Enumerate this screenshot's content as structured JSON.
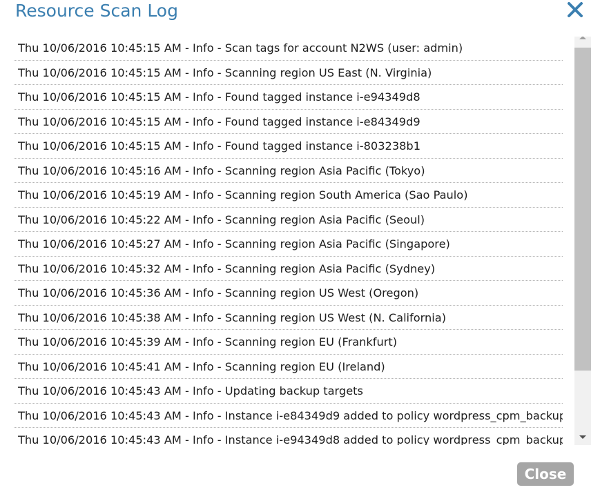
{
  "dialog": {
    "title": "Resource Scan Log",
    "close_icon": "close-x-icon",
    "close_button_label": "Close",
    "accent_color": "#3b7fb0",
    "button_color": "#a6a6a6"
  },
  "log": {
    "entries": [
      "Thu 10/06/2016 10:45:15 AM - Info - Scan tags for account N2WS (user: admin)",
      "Thu 10/06/2016 10:45:15 AM - Info - Scanning region US East (N. Virginia)",
      "Thu 10/06/2016 10:45:15 AM - Info - Found tagged instance i-e94349d8",
      "Thu 10/06/2016 10:45:15 AM - Info - Found tagged instance i-e84349d9",
      "Thu 10/06/2016 10:45:15 AM - Info - Found tagged instance i-803238b1",
      "Thu 10/06/2016 10:45:16 AM - Info - Scanning region Asia Pacific (Tokyo)",
      "Thu 10/06/2016 10:45:19 AM - Info - Scanning region South America (Sao Paulo)",
      "Thu 10/06/2016 10:45:22 AM - Info - Scanning region Asia Pacific (Seoul)",
      "Thu 10/06/2016 10:45:27 AM - Info - Scanning region Asia Pacific (Singapore)",
      "Thu 10/06/2016 10:45:32 AM - Info - Scanning region Asia Pacific (Sydney)",
      "Thu 10/06/2016 10:45:36 AM - Info - Scanning region US West (Oregon)",
      "Thu 10/06/2016 10:45:38 AM - Info - Scanning region US West (N. California)",
      "Thu 10/06/2016 10:45:39 AM - Info - Scanning region EU (Frankfurt)",
      "Thu 10/06/2016 10:45:41 AM - Info - Scanning region EU (Ireland)",
      "Thu 10/06/2016 10:45:43 AM - Info - Updating backup targets",
      "Thu 10/06/2016 10:45:43 AM - Info - Instance i-e84349d9 added to policy wordpress_cpm_backup",
      "Thu 10/06/2016 10:45:43 AM - Info - Instance i-e94349d8 added to policy wordpress_cpm_backup"
    ]
  },
  "scrollbar": {
    "up_icon": "scroll-up-arrow-icon",
    "down_icon": "scroll-down-arrow-icon"
  }
}
